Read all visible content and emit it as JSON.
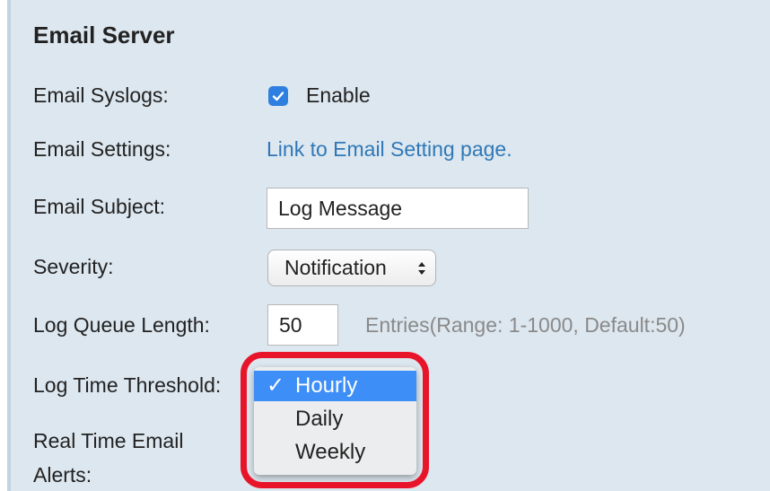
{
  "section": {
    "title": "Email Server"
  },
  "email_syslogs": {
    "label": "Email Syslogs:",
    "checkbox_label": "Enable",
    "checked": true
  },
  "email_settings": {
    "label": "Email Settings:",
    "link_text": "Link to Email Setting page."
  },
  "email_subject": {
    "label": "Email Subject:",
    "value": "Log Message"
  },
  "severity": {
    "label": "Severity:",
    "selected": "Notification"
  },
  "log_queue_length": {
    "label": "Log Queue Length:",
    "value": "50",
    "hint": "Entries(Range: 1-1000, Default:50)"
  },
  "log_time_threshold": {
    "label": "Log Time Threshold:",
    "options": [
      {
        "label": "Hourly",
        "selected": true
      },
      {
        "label": "Daily",
        "selected": false
      },
      {
        "label": "Weekly",
        "selected": false
      }
    ],
    "check_glyph": "✓"
  },
  "real_time_alerts": {
    "label_line1": "Real Time Email",
    "label_line2": "Alerts:"
  },
  "colors": {
    "panel_bg": "#dde7ef",
    "link": "#2f78b7",
    "checkbox": "#2f7fe0",
    "menu_highlight": "#3e8ef7",
    "annotation_ring": "#e8152a"
  }
}
